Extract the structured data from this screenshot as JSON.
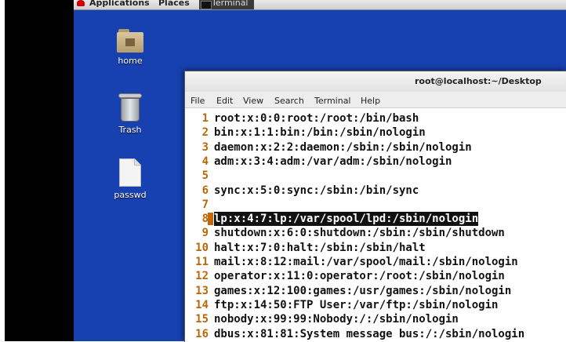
{
  "top_panel": {
    "applications": "Applications",
    "places": "Places",
    "terminal": "Terminal"
  },
  "desktop": {
    "icons": [
      {
        "label": "home"
      },
      {
        "label": "Trash"
      },
      {
        "label": "passwd"
      }
    ]
  },
  "terminal": {
    "title": "root@localhost:~/Desktop",
    "menu": [
      "File",
      "Edit",
      "View",
      "Search",
      "Terminal",
      "Help"
    ],
    "highlighted_line": 8,
    "lines": [
      {
        "num": "1",
        "text": "root:x:0:0:root:/root:/bin/bash"
      },
      {
        "num": "2",
        "text": "bin:x:1:1:bin:/bin:/sbin/nologin"
      },
      {
        "num": "3",
        "text": "daemon:x:2:2:daemon:/sbin:/sbin/nologin"
      },
      {
        "num": "4",
        "text": "adm:x:3:4:adm:/var/adm:/sbin/nologin"
      },
      {
        "num": "5",
        "text": ""
      },
      {
        "num": "6",
        "text": "sync:x:5:0:sync:/sbin:/bin/sync"
      },
      {
        "num": "7",
        "text": ""
      },
      {
        "num": "8",
        "text": "lp:x:4:7:lp:/var/spool/lpd:/sbin/nologin"
      },
      {
        "num": "9",
        "text": "shutdown:x:6:0:shutdown:/sbin:/sbin/shutdown"
      },
      {
        "num": "10",
        "text": "halt:x:7:0:halt:/sbin:/sbin/halt"
      },
      {
        "num": "11",
        "text": "mail:x:8:12:mail:/var/spool/mail:/sbin/nologin"
      },
      {
        "num": "12",
        "text": "operator:x:11:0:operator:/root:/sbin/nologin"
      },
      {
        "num": "13",
        "text": "games:x:12:100:games:/usr/games:/sbin/nologin"
      },
      {
        "num": "14",
        "text": "ftp:x:14:50:FTP User:/var/ftp:/sbin/nologin"
      },
      {
        "num": "15",
        "text": "nobody:x:99:99:Nobody:/:/sbin/nologin"
      },
      {
        "num": "16",
        "text": "dbus:x:81:81:System message bus:/:/sbin/nologin"
      }
    ]
  },
  "colors": {
    "desktop_bg": "#1741b0",
    "line_number": "#b8680a",
    "cursor": "#c3690b"
  }
}
